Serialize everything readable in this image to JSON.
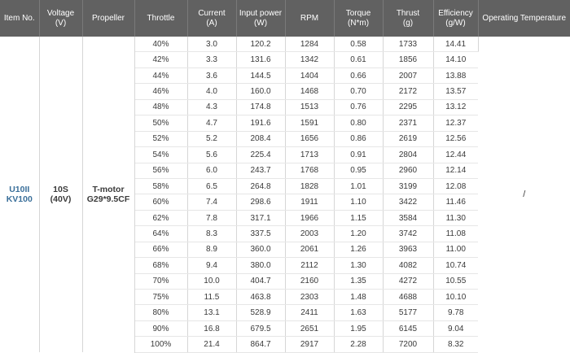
{
  "headers": [
    {
      "label": "Item No.",
      "unit": ""
    },
    {
      "label": "Voltage",
      "unit": "(V)"
    },
    {
      "label": "Propeller",
      "unit": ""
    },
    {
      "label": "Throttle",
      "unit": ""
    },
    {
      "label": "Current",
      "unit": "(A)"
    },
    {
      "label": "Input power",
      "unit": "(W)"
    },
    {
      "label": "RPM",
      "unit": ""
    },
    {
      "label": "Torque",
      "unit": "(N*m)"
    },
    {
      "label": "Thrust",
      "unit": "(g)"
    },
    {
      "label": "Efficiency",
      "unit": "(g/W)"
    },
    {
      "label": "Operating Temperature",
      "unit": ""
    }
  ],
  "item_no": [
    "U10II",
    "KV100"
  ],
  "voltage": [
    "10S",
    "(40V)"
  ],
  "propeller": [
    "T-motor",
    "G29*9.5CF"
  ],
  "operating_temperature": "/",
  "rows": [
    [
      "40%",
      "3.0",
      "120.2",
      "1284",
      "0.58",
      "1733",
      "14.41"
    ],
    [
      "42%",
      "3.3",
      "131.6",
      "1342",
      "0.61",
      "1856",
      "14.10"
    ],
    [
      "44%",
      "3.6",
      "144.5",
      "1404",
      "0.66",
      "2007",
      "13.88"
    ],
    [
      "46%",
      "4.0",
      "160.0",
      "1468",
      "0.70",
      "2172",
      "13.57"
    ],
    [
      "48%",
      "4.3",
      "174.8",
      "1513",
      "0.76",
      "2295",
      "13.12"
    ],
    [
      "50%",
      "4.7",
      "191.6",
      "1591",
      "0.80",
      "2371",
      "12.37"
    ],
    [
      "52%",
      "5.2",
      "208.4",
      "1656",
      "0.86",
      "2619",
      "12.56"
    ],
    [
      "54%",
      "5.6",
      "225.4",
      "1713",
      "0.91",
      "2804",
      "12.44"
    ],
    [
      "56%",
      "6.0",
      "243.7",
      "1768",
      "0.95",
      "2960",
      "12.14"
    ],
    [
      "58%",
      "6.5",
      "264.8",
      "1828",
      "1.01",
      "3199",
      "12.08"
    ],
    [
      "60%",
      "7.4",
      "298.6",
      "1911",
      "1.10",
      "3422",
      "11.46"
    ],
    [
      "62%",
      "7.8",
      "317.1",
      "1966",
      "1.15",
      "3584",
      "11.30"
    ],
    [
      "64%",
      "8.3",
      "337.5",
      "2003",
      "1.20",
      "3742",
      "11.08"
    ],
    [
      "66%",
      "8.9",
      "360.0",
      "2061",
      "1.26",
      "3963",
      "11.00"
    ],
    [
      "68%",
      "9.4",
      "380.0",
      "2112",
      "1.30",
      "4082",
      "10.74"
    ],
    [
      "70%",
      "10.0",
      "404.7",
      "2160",
      "1.35",
      "4272",
      "10.55"
    ],
    [
      "75%",
      "11.5",
      "463.8",
      "2303",
      "1.48",
      "4688",
      "10.10"
    ],
    [
      "80%",
      "13.1",
      "528.9",
      "2411",
      "1.63",
      "5177",
      "9.78"
    ],
    [
      "90%",
      "16.8",
      "679.5",
      "2651",
      "1.95",
      "6145",
      "9.04"
    ],
    [
      "100%",
      "21.4",
      "864.7",
      "2917",
      "2.28",
      "7200",
      "8.32"
    ]
  ]
}
